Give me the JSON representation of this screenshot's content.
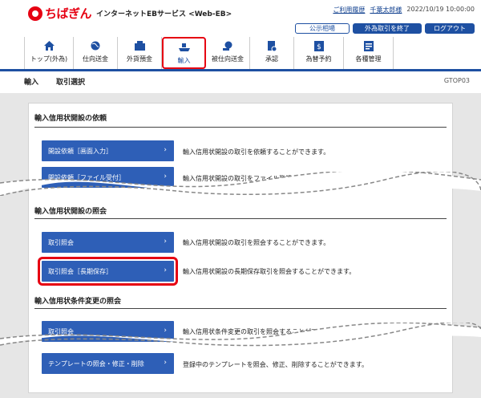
{
  "header": {
    "logo_text": "ちばぎん",
    "service_name": "インターネットEBサービス <Web-EB>",
    "usage_history_link": "ご利用履歴",
    "user_name": "千葉太郎様",
    "datetime": "2022/10/19 10:00:00",
    "buttons": {
      "public_rates": "公示相場",
      "end_fx": "外為取引を終了",
      "logout": "ログアウト"
    }
  },
  "nav": {
    "items": [
      {
        "label": "トップ(外為)",
        "icon": "home-icon"
      },
      {
        "label": "仕向送金",
        "icon": "globe-icon"
      },
      {
        "label": "外貨預金",
        "icon": "deposit-icon"
      },
      {
        "label": "輸入",
        "icon": "ship-icon"
      },
      {
        "label": "被仕向送金",
        "icon": "receive-money-icon"
      },
      {
        "label": "承認",
        "icon": "approval-icon"
      },
      {
        "label": "為替予約",
        "icon": "exchange-icon"
      },
      {
        "label": "各種管理",
        "icon": "management-icon"
      }
    ],
    "active_index": 3
  },
  "breadcrumb": {
    "category": "輸入",
    "page": "取引選択",
    "screen_id": "GTOP03"
  },
  "sections": [
    {
      "title": "輸入信用状開設の依頼",
      "rows": [
        {
          "button": "開設依頼［画面入力］",
          "desc": "輸入信用状開設の取引を依頼することができます。"
        },
        {
          "button": "開設依頼［ファイル受付］",
          "desc": "輸入信用状開設の取引をファイル登録で一括依頼することができます。"
        }
      ]
    },
    {
      "title": "輸入信用状開設の照会",
      "rows": [
        {
          "button": "取引照会",
          "desc": "輸入信用状開設の取引を照会することができます。"
        },
        {
          "button": "取引照会［長期保存］",
          "desc": "輸入信用状開設の長期保存取引を照会することができます。"
        }
      ]
    },
    {
      "title": "輸入信用状条件変更の照会",
      "rows": [
        {
          "button": "取引照会",
          "desc": "輸入信用状条件変更の取引を照会することができます。"
        },
        {
          "button": "テンプレートの照会・修正・削除",
          "desc": "登録中のテンプレートを照会、修正、削除することができます。"
        }
      ]
    }
  ],
  "colors": {
    "brand_red": "#e60012",
    "primary_blue": "#1e50a2",
    "button_blue": "#2e5fb7"
  }
}
